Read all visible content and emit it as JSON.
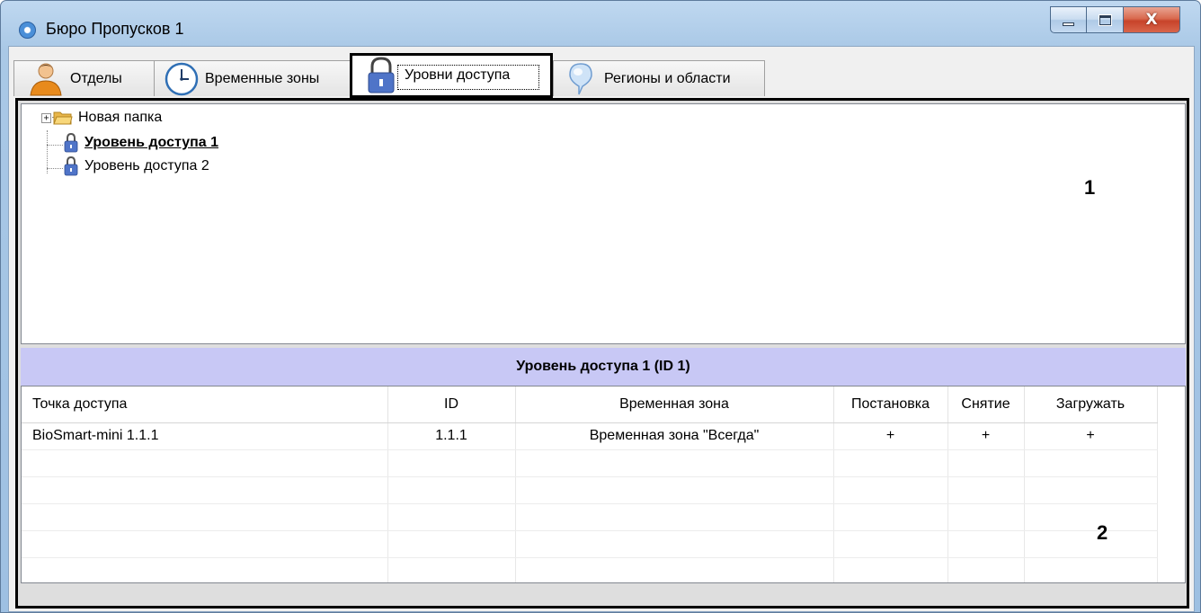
{
  "window": {
    "title": "Бюро Пропусков 1",
    "controls": {
      "minimize": "minimize",
      "maximize": "maximize",
      "close": "X"
    },
    "accent": "#9ec0e2"
  },
  "tabs": [
    {
      "label": "Отделы",
      "icon": "person-icon"
    },
    {
      "label": "Временные зоны",
      "icon": "clock-icon"
    },
    {
      "label": "Уровни доступа",
      "icon": "padlock-icon",
      "active": true
    },
    {
      "label": "Регионы и области",
      "icon": "map-pin-icon"
    }
  ],
  "tree": {
    "items": [
      {
        "label": "Новая папка",
        "icon": "folder-icon",
        "expander": "+"
      },
      {
        "label": "Уровень доступа 1",
        "icon": "padlock-icon",
        "selected": true
      },
      {
        "label": "Уровень доступа 2",
        "icon": "padlock-icon"
      }
    ]
  },
  "callouts": {
    "top": "1",
    "bottom": "2"
  },
  "detail": {
    "header": "Уровень доступа 1 (ID 1)",
    "header_color": "#c8c8f5",
    "columns": [
      "Точка доступа",
      "ID",
      "Временная зона",
      "Постановка",
      "Снятие",
      "Загружать"
    ],
    "rows": [
      [
        "BioSmart-mini 1.1.1",
        "1.1.1",
        "Временная зона \"Всегда\"",
        "+",
        "+",
        "+"
      ]
    ]
  }
}
